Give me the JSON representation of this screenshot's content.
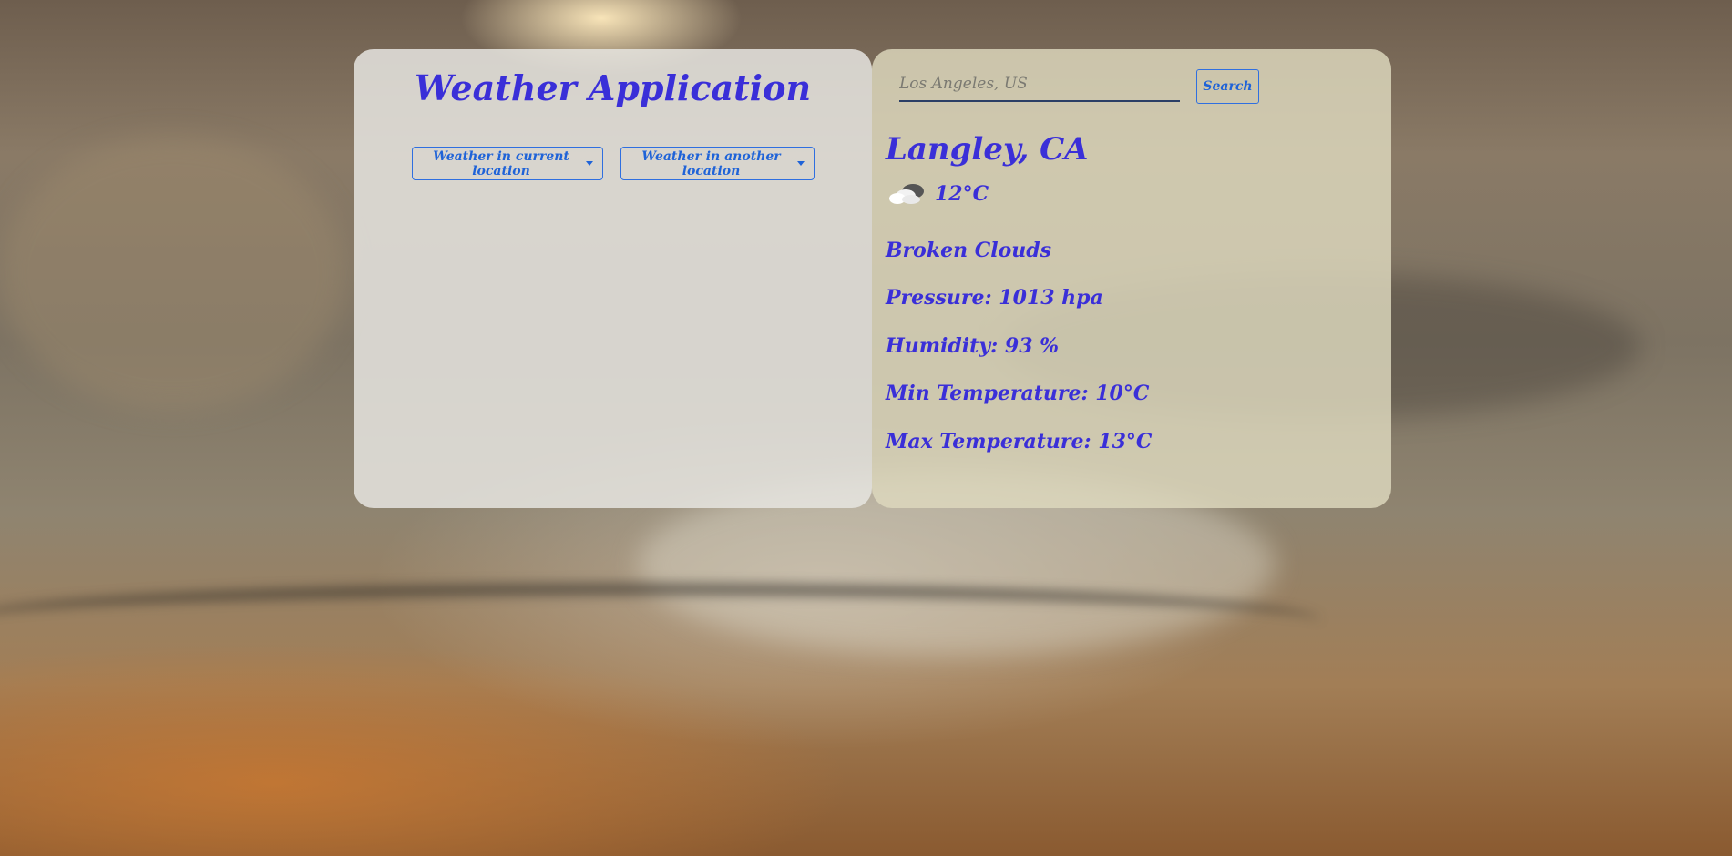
{
  "app": {
    "title": "Weather Application"
  },
  "location_menu": {
    "current_label": "Weather in current location",
    "another_label": "Weather in another location"
  },
  "search": {
    "placeholder": "Los Angeles, US",
    "value": "",
    "button_label": "Search"
  },
  "weather": {
    "city": "Langley, CA",
    "icon": "broken-clouds-icon",
    "temperature": "12°C",
    "description": "Broken Clouds",
    "pressure": "Pressure: 1013 hpa",
    "humidity": "Humidity: 93 %",
    "min_temp": "Min Temperature: 10°C",
    "max_temp": "Max Temperature: 13°C"
  },
  "colors": {
    "text_accent": "#3a2fd8",
    "button_outline": "#2f6fe0"
  }
}
